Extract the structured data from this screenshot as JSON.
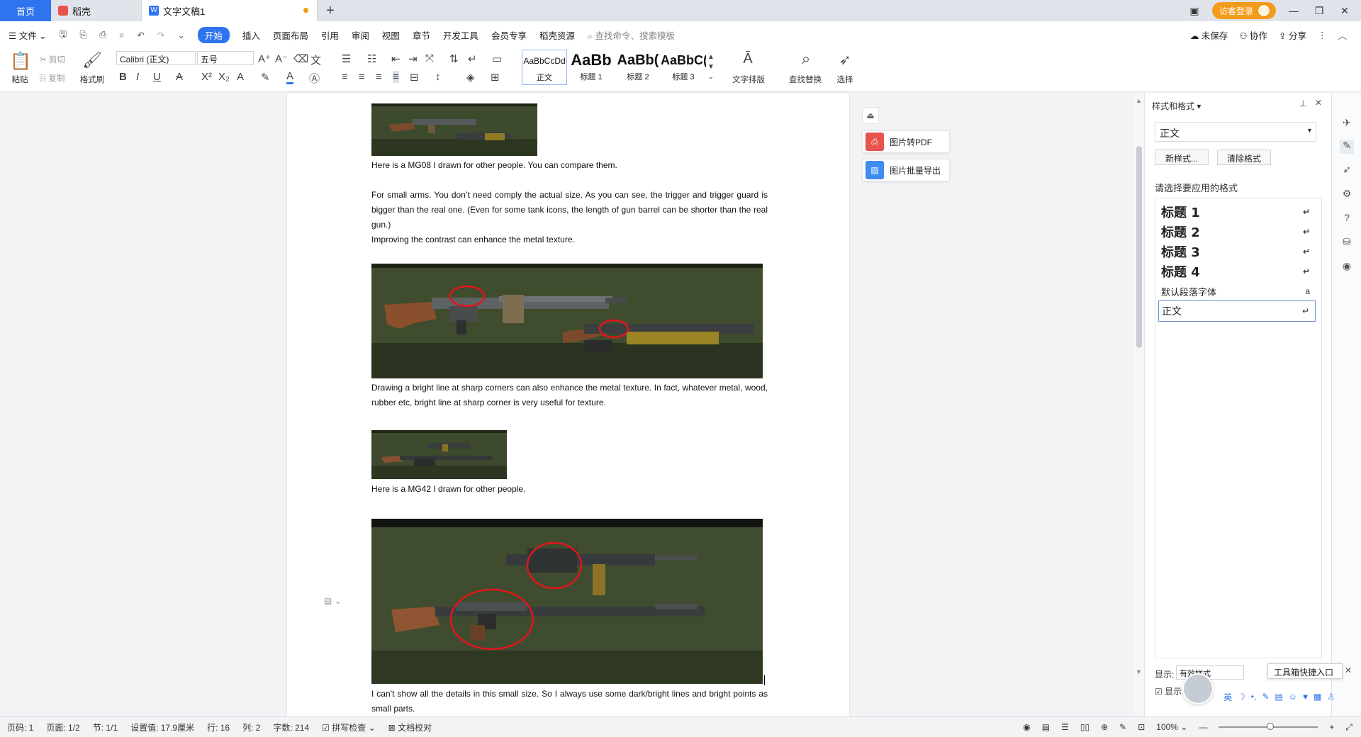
{
  "tabs": {
    "home": "首页",
    "docer": "稻壳",
    "doc": "文字文稿1",
    "add": "+"
  },
  "titlebar": {
    "login": "访客登录"
  },
  "menu": {
    "file": "文件",
    "items": [
      "开始",
      "插入",
      "页面布局",
      "引用",
      "审阅",
      "视图",
      "章节",
      "开发工具",
      "会员专享",
      "稻壳资源"
    ],
    "search": "查找命令、搜索模板",
    "unsaved": "未保存",
    "collab": "协作",
    "share": "分享"
  },
  "ribbon": {
    "paste": "粘贴",
    "cut": "剪切",
    "copy": "复制",
    "format_painter": "格式刷",
    "font": "Calibri (正文)",
    "size": "五号",
    "styles": [
      {
        "preview": "AaBbCcDd",
        "name": "正文"
      },
      {
        "preview": "AaBb",
        "name": "标题 1"
      },
      {
        "preview": "AaBb(",
        "name": "标题 2"
      },
      {
        "preview": "AaBbC(",
        "name": "标题 3"
      }
    ],
    "text_layout": "文字排版",
    "find_replace": "查找替换",
    "select": "选择"
  },
  "document": {
    "p1": "Here is a MG08 I drawn for other people. You can compare them.",
    "p2": "For small arms. You don’t need comply the actual size. As you can see, the trigger and trigger guard is bigger than the real one. (Even for some tank icons, the length of gun barrel can be shorter than the real gun.)",
    "p3": "Improving the contrast can enhance the metal texture.",
    "p4": "Drawing a bright line at sharp corners can also enhance the metal texture. In fact, whatever metal, wood, rubber etc, bright line at sharp corner is very useful for texture.",
    "p5": "Here is a MG42 I drawn for other people.",
    "p6": "I can’t show all the details in this small size. So I always use some dark/bright lines and bright points as small parts."
  },
  "float_tools": {
    "pdf": "图片转PDF",
    "export": "图片批量导出"
  },
  "style_panel": {
    "title": "样式和格式",
    "current": "正文",
    "new_style": "新样式...",
    "clear_format": "清除格式",
    "choose_label": "请选择要应用的格式",
    "items": [
      "标题 1",
      "标题 2",
      "标题 3",
      "标题 4",
      "默认段落字体",
      "正文"
    ],
    "show_label": "显示:",
    "show_value": "有效样式",
    "show_preview": "显示"
  },
  "tool_popup": "工具箱快捷入口",
  "ime": [
    "英",
    "☽",
    "•,",
    "✎",
    "▤",
    "☺",
    "♥",
    "▦",
    "♙"
  ],
  "status": {
    "page_code": "页码: 1",
    "pages": "页面: 1/2",
    "section": "节: 1/1",
    "setting": "设置值: 17.9厘米",
    "row": "行: 16",
    "col": "列: 2",
    "words": "字数: 214",
    "spell": "拼写检查",
    "proof": "文档校对",
    "zoom": "100%"
  },
  "colors": {
    "accent": "#2f74ef",
    "login": "#f59b1c",
    "pdf_icon": "#e8534d",
    "export_icon": "#3f8cf0",
    "annotation_red": "#e3141b"
  }
}
